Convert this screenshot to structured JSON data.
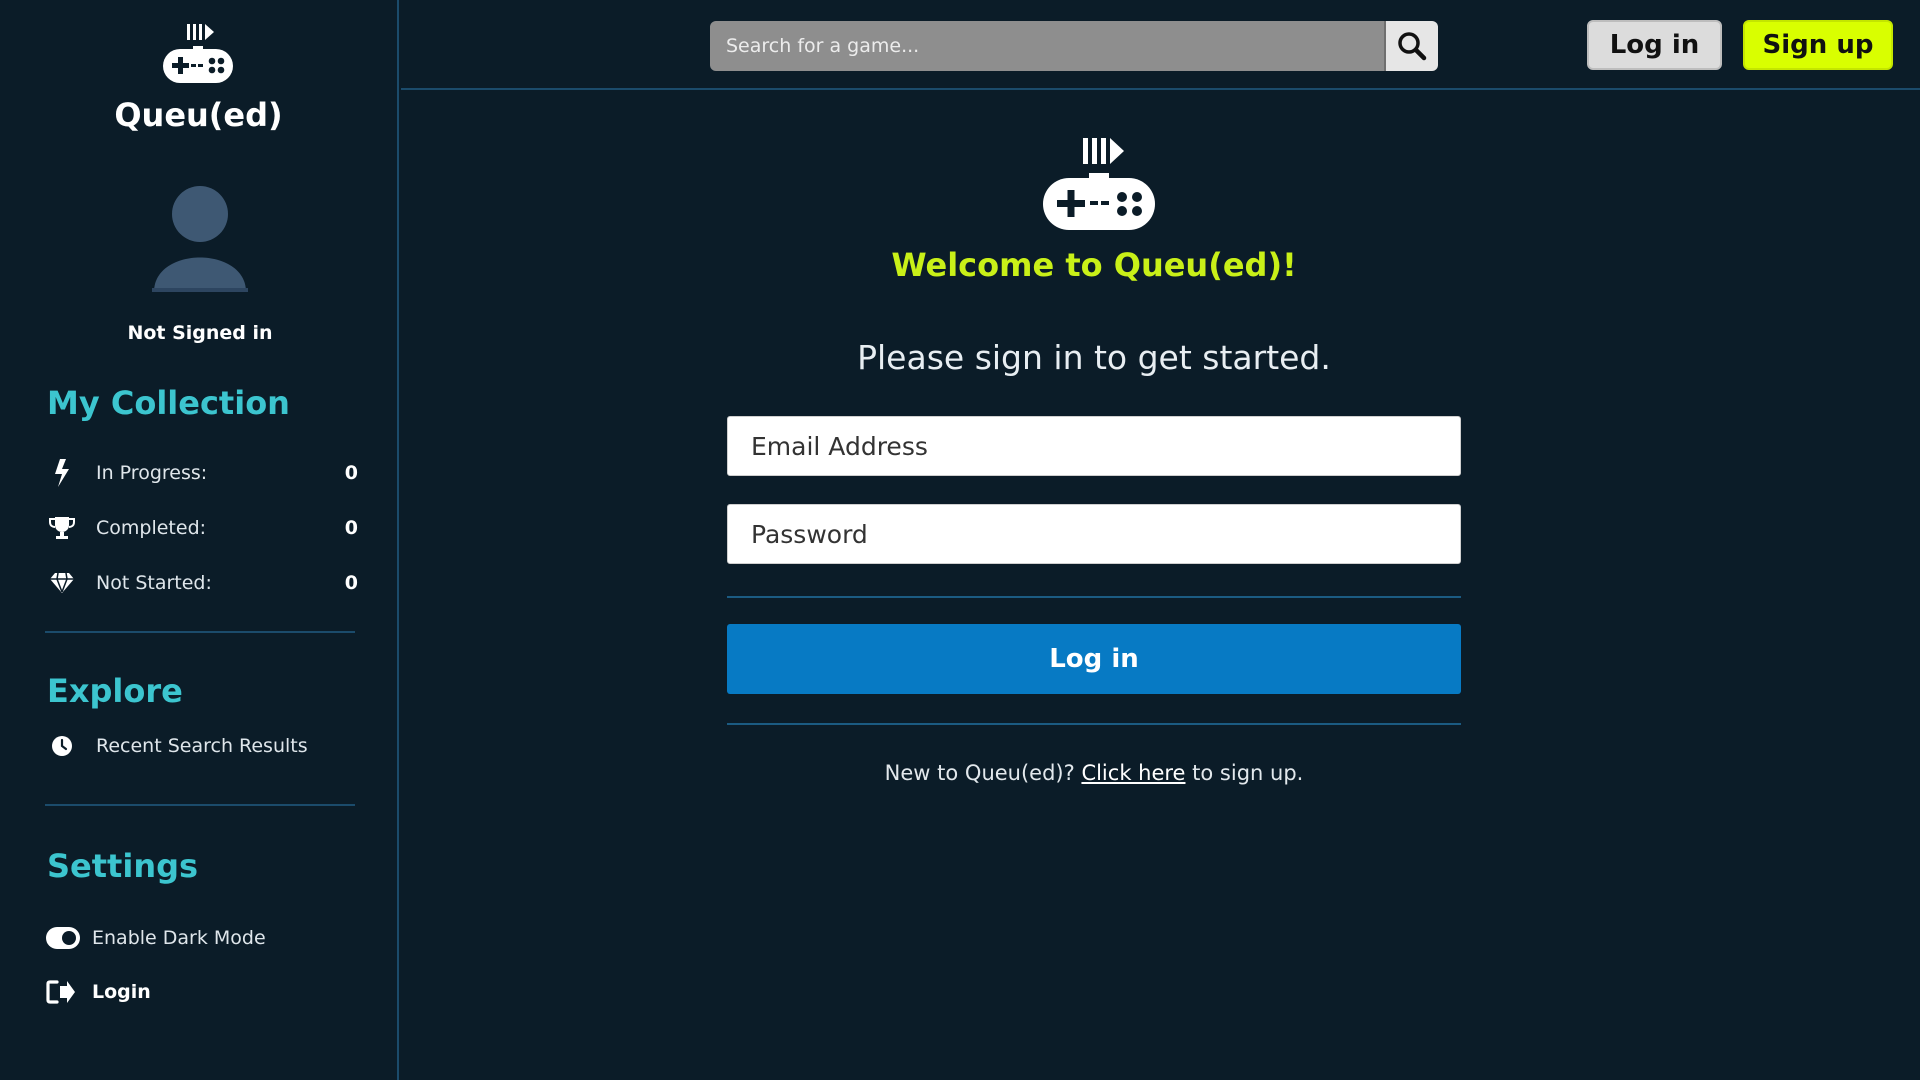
{
  "brand": {
    "name": "Queu(ed)",
    "logo_icon": "gamepad-queue-logo"
  },
  "user": {
    "status": "Not Signed in",
    "avatar_icon": "user-silhouette"
  },
  "sidebar": {
    "collection": {
      "title": "My Collection",
      "items": [
        {
          "icon": "bolt-icon",
          "label": "In Progress:",
          "count": "0"
        },
        {
          "icon": "trophy-icon",
          "label": "Completed:",
          "count": "0"
        },
        {
          "icon": "gem-icon",
          "label": "Not Started:",
          "count": "0"
        }
      ]
    },
    "explore": {
      "title": "Explore",
      "items": [
        {
          "icon": "clock-icon",
          "label": "Recent Search Results"
        }
      ]
    },
    "settings": {
      "title": "Settings",
      "dark_mode_label": "Enable Dark Mode",
      "dark_mode_enabled": true,
      "login_label": "Login"
    }
  },
  "header": {
    "search_placeholder": "Search for a game...",
    "login_label": "Log in",
    "signup_label": "Sign up"
  },
  "main": {
    "welcome": "Welcome to Queu(ed)!",
    "subtitle": "Please sign in to get started.",
    "email_placeholder": "Email Address",
    "password_placeholder": "Password",
    "login_button": "Log in",
    "signup_prefix": "New to Queu(ed)? ",
    "signup_link": "Click here",
    "signup_suffix": " to sign up."
  },
  "colors": {
    "background": "#0b1c28",
    "accent_teal": "#3cc5cf",
    "accent_lime": "#d9ff00",
    "primary_blue": "#077ac4",
    "divider": "#1b4b6b"
  }
}
